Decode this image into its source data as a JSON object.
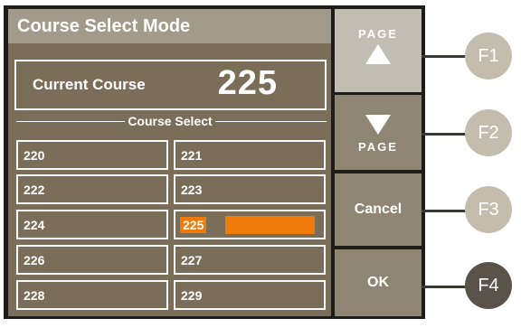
{
  "screen": {
    "title": "Course Select Mode",
    "current_label": "Current Course",
    "current_value": "225",
    "section_label": "Course Select"
  },
  "courses": [
    "220",
    "221",
    "222",
    "223",
    "224",
    "225",
    "226",
    "227",
    "228",
    "229"
  ],
  "selected_course": "225",
  "side_buttons": {
    "page_up_word": "PAGE",
    "page_down_word": "PAGE",
    "cancel": "Cancel",
    "ok": "OK"
  },
  "function_keys": [
    "F1",
    "F2",
    "F3",
    "F4"
  ],
  "colors": {
    "screen_bg": "#7b6e59",
    "title_bg": "#a29a8a",
    "highlight": "#f07a0a",
    "side_light": "#c2bdb2",
    "side_dark": "#8e8573"
  }
}
